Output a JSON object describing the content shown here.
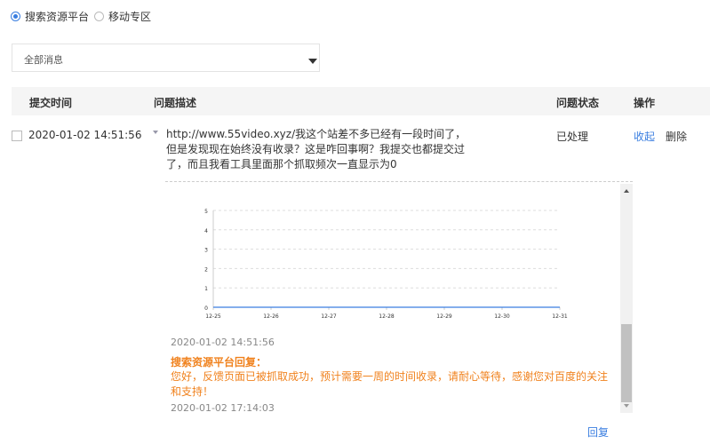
{
  "platform_filter": {
    "options": [
      {
        "label": "搜索资源平台",
        "selected": true
      },
      {
        "label": "移动专区",
        "selected": false
      }
    ]
  },
  "message_filter": {
    "selected": "全部消息"
  },
  "table": {
    "headers": {
      "time": "提交时间",
      "description": "问题描述",
      "status": "问题状态",
      "actions": "操作"
    }
  },
  "row": {
    "checked": false,
    "time": "2020-01-02 14:51:56",
    "description": "http://www.55video.xyz/我这个站差不多已经有一段时间了，但是发现现在始终没有收录？这是咋回事啊？我提交也都提交过了，而且我看工具里面那个抓取频次一直显示为0",
    "status": "已处理",
    "action_collapse": "收起",
    "action_delete": "删除"
  },
  "detail": {
    "submit_time": "2020-01-02 14:51:56",
    "reply_author": "搜索资源平台回复：",
    "reply_text": "您好，反馈页面已被抓取成功，预计需要一周的时间收录，请耐心等待，感谢您对百度的关注和支持！",
    "reply_time": "2020-01-02 17:14:03"
  },
  "reply_button": "回复",
  "chart_data": {
    "type": "line",
    "x": [
      "12-25",
      "12-26",
      "12-27",
      "12-28",
      "12-29",
      "12-30",
      "12-31"
    ],
    "values": [
      0,
      0,
      0,
      0,
      0,
      0,
      0
    ],
    "yticks": [
      0,
      1,
      2,
      3,
      4,
      5
    ],
    "ylim": [
      0,
      5
    ],
    "grid": true,
    "line_color": "#3a7ee0"
  },
  "colors": {
    "accent": "#3a7ee0",
    "reply": "#f0821e"
  }
}
